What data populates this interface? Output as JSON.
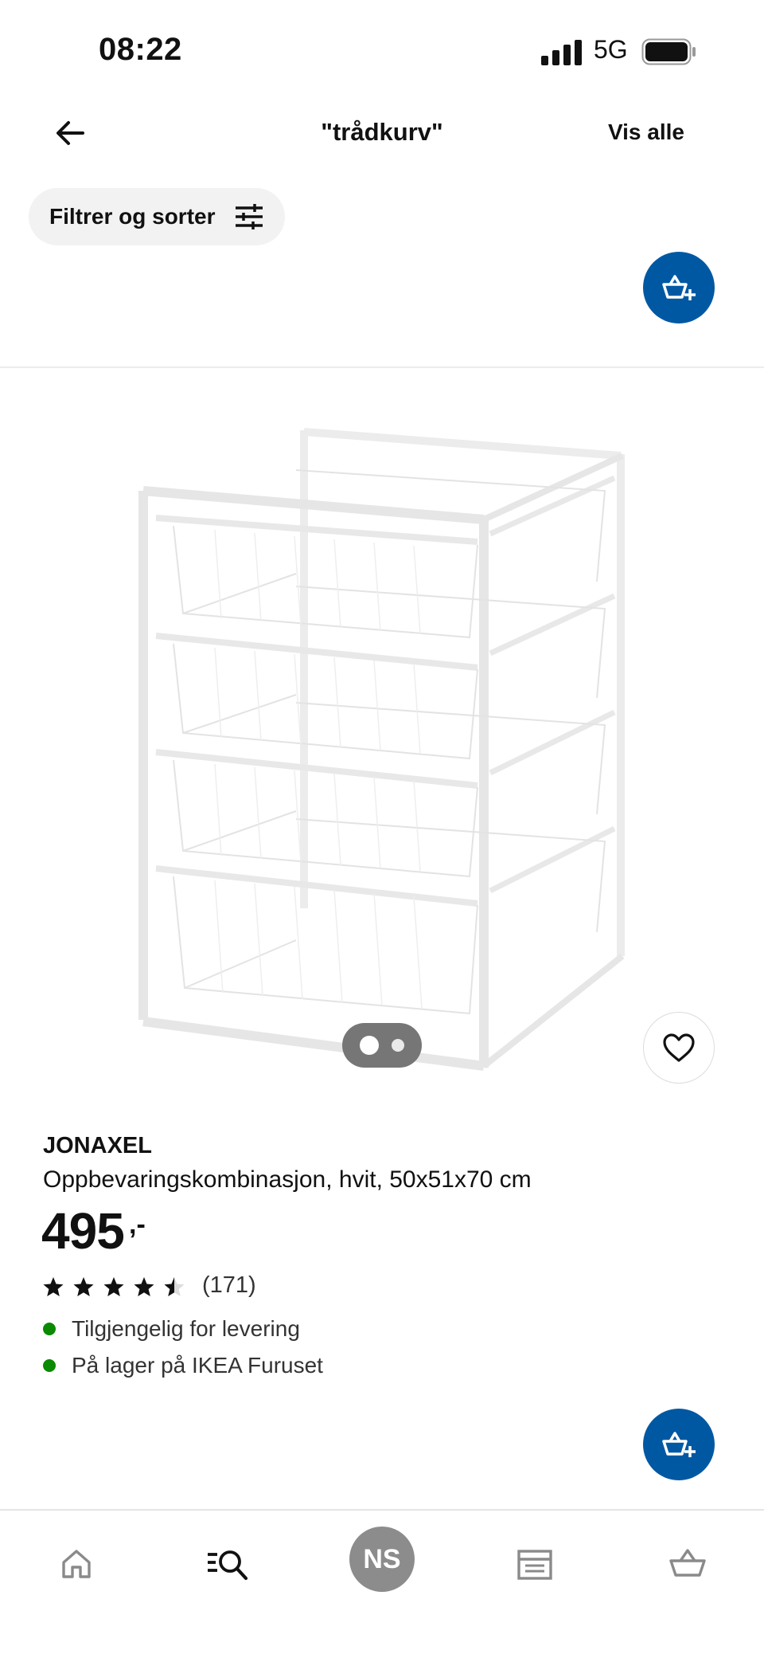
{
  "status_bar": {
    "time": "08:22",
    "network": "5G"
  },
  "header": {
    "title": "\"trådkurv\"",
    "view_all": "Vis alle"
  },
  "filter": {
    "label": "Filtrer og sorter"
  },
  "product": {
    "name": "JONAXEL",
    "description": "Oppbevaringskombinasjon, hvit, 50x51x70 cm",
    "price": "495",
    "price_suffix": ",-",
    "rating": 4.5,
    "review_count": "(171)",
    "availability": [
      {
        "text": "Tilgjengelig for levering",
        "status_color": "#0a8a00"
      },
      {
        "text": "På lager på IKEA Furuset",
        "status_color": "#0a8a00"
      }
    ],
    "image_count": 2,
    "image_selected": 1
  },
  "nav": {
    "items": [
      {
        "icon": "home-icon"
      },
      {
        "icon": "search-list-icon"
      },
      {
        "icon": "profile-avatar",
        "initials": "NS"
      },
      {
        "icon": "store-icon"
      },
      {
        "icon": "cart-icon"
      }
    ]
  },
  "colors": {
    "accent": "#0058a3",
    "available": "#0a8a00",
    "avatar": "#8c8c8c"
  }
}
